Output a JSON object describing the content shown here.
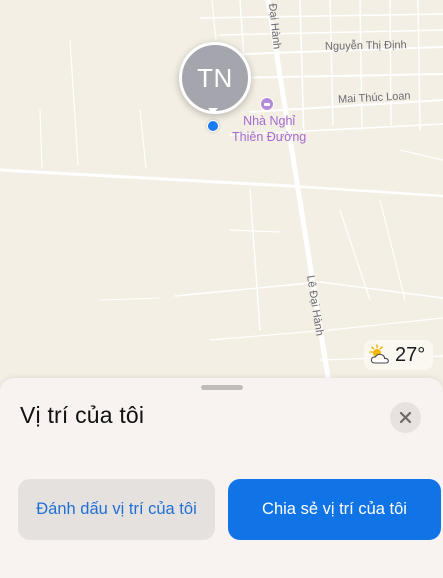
{
  "map": {
    "streets": [
      {
        "name": "Đại Hành"
      },
      {
        "name": "Nguyễn Thị Định"
      },
      {
        "name": "Mai Thúc Loan"
      },
      {
        "name": "Lê Đại Hành"
      }
    ],
    "poi": {
      "icon": "bed-icon",
      "name_line1": "Nhà Nghỉ",
      "name_line2": "Thiên Đường"
    },
    "user_pin": {
      "initials": "TN"
    },
    "weather": {
      "icon": "partly-cloudy-icon",
      "temperature": "27°"
    }
  },
  "sheet": {
    "title": "Vị trí của tôi",
    "close_icon": "close-icon",
    "mark_button": "Đánh dấu vị trí của tôi",
    "share_button": "Chia sẻ vị trí của tôi"
  },
  "colors": {
    "map_background": "#f4efe4",
    "accent_blue": "#1174e6",
    "poi_purple": "#a46bd0",
    "avatar_gray": "#a5a5ad"
  }
}
